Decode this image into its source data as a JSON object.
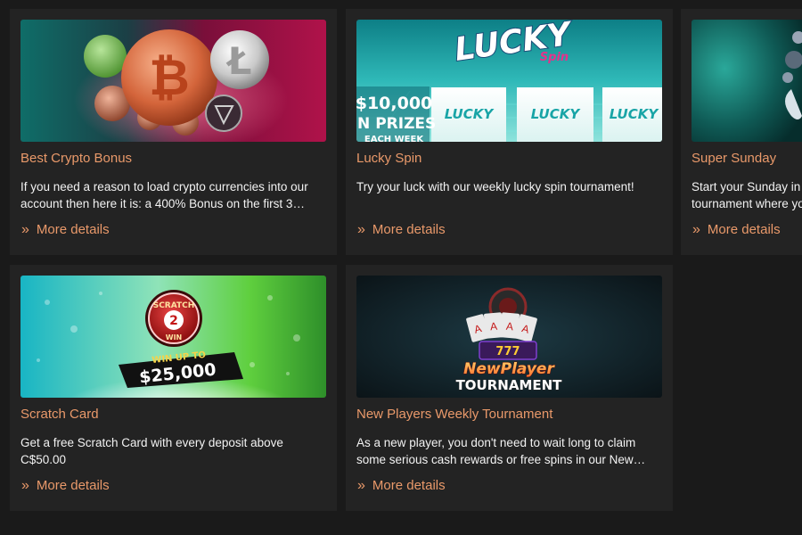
{
  "promotions": [
    {
      "title": "Best Crypto Bonus",
      "description": "If you need a reason to load crypto currencies into our account then here it is: a 400% Bonus on the first 3…",
      "link": "More details"
    },
    {
      "title": "Lucky Spin",
      "description": "Try your luck with our weekly lucky spin tournament!",
      "link": "More details",
      "banner": {
        "logo": "LUCKY",
        "logo_sub": "Spin",
        "prize_line1": "$10,000",
        "prize_line2": "IN PRIZES",
        "prize_line3": "EACH WEEK",
        "reel_text": "LUCKY"
      }
    },
    {
      "title": "Super Sunday",
      "description": "Start your Sunday in s tournament where you",
      "link": "More details"
    },
    {
      "title": "Scratch Card",
      "description": "Get a free Scratch Card with every deposit above C$50.00",
      "link": "More details",
      "banner": {
        "badge_top": "SCRATCH",
        "badge_num": "2",
        "badge_bottom": "WIN",
        "win_line": "WIN UP TO",
        "amount": "$25,000"
      }
    },
    {
      "title": "New Players Weekly Tournament",
      "description": "As a new player, you don't need to wait long to claim some serious cash rewards or free spins in our New…",
      "link": "More details",
      "banner": {
        "line1": "NewPlayer",
        "line2": "TOURNAMENT"
      }
    }
  ],
  "colors": {
    "page_bg": "#1a1a1a",
    "card_bg": "#232323",
    "accent": "#e9996a",
    "text": "#f2f2f2"
  },
  "icons": {
    "more_link": "double-chevron-right-icon"
  }
}
